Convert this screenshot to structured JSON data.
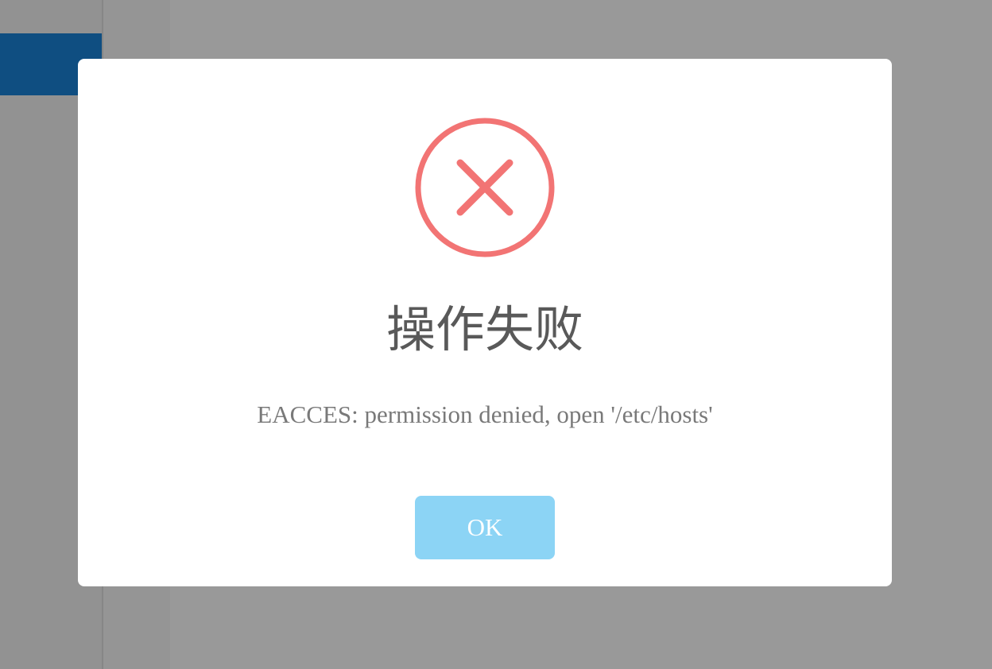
{
  "dialog": {
    "title": "操作失败",
    "message": "EACCES: permission denied, open '/etc/hosts'",
    "ok_label": "OK",
    "icon": "error-x-icon"
  },
  "colors": {
    "error_accent": "#f27474",
    "title_text": "#595959",
    "message_text": "#797979",
    "ok_button_bg": "#8cd4f5",
    "sidebar_active": "#1a82d8",
    "overlay": "rgba(0,0,0,0.4)"
  }
}
